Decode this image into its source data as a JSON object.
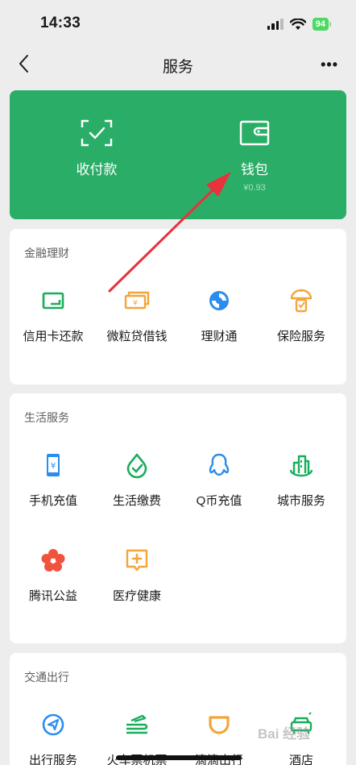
{
  "status_bar": {
    "time": "14:33",
    "battery": "94"
  },
  "nav": {
    "title": "服务",
    "more": "•••"
  },
  "wallet_card": {
    "pay": {
      "label": "收付款"
    },
    "wallet": {
      "label": "钱包",
      "balance": "¥0.93"
    }
  },
  "finance": {
    "title": "金融理财",
    "items": [
      {
        "label": "信用卡还款",
        "icon": "credit-card-icon"
      },
      {
        "label": "微粒贷借钱",
        "icon": "loan-icon"
      },
      {
        "label": "理财通",
        "icon": "licaitong-icon"
      },
      {
        "label": "保险服务",
        "icon": "insurance-icon"
      }
    ]
  },
  "life": {
    "title": "生活服务",
    "items": [
      {
        "label": "手机充值",
        "icon": "phone-topup-icon"
      },
      {
        "label": "生活缴费",
        "icon": "utility-bill-icon"
      },
      {
        "label": "Q币充值",
        "icon": "qq-coin-icon"
      },
      {
        "label": "城市服务",
        "icon": "city-service-icon"
      },
      {
        "label": "腾讯公益",
        "icon": "charity-icon"
      },
      {
        "label": "医疗健康",
        "icon": "medical-icon"
      }
    ]
  },
  "travel": {
    "title": "交通出行",
    "items": [
      {
        "label": "出行服务",
        "icon": "travel-service-icon"
      },
      {
        "label": "火车票机票",
        "icon": "train-ticket-icon"
      },
      {
        "label": "滴滴出行",
        "icon": "didi-icon"
      },
      {
        "label": "酒店",
        "icon": "hotel-icon"
      }
    ]
  },
  "colors": {
    "brand_green": "#2aae67",
    "icon_green": "#1aad5c",
    "icon_orange": "#f4a53a",
    "icon_blue": "#2a8cf0",
    "icon_red": "#f0533d",
    "annotation_arrow": "#e8323c"
  },
  "watermark": "Bai 经验"
}
